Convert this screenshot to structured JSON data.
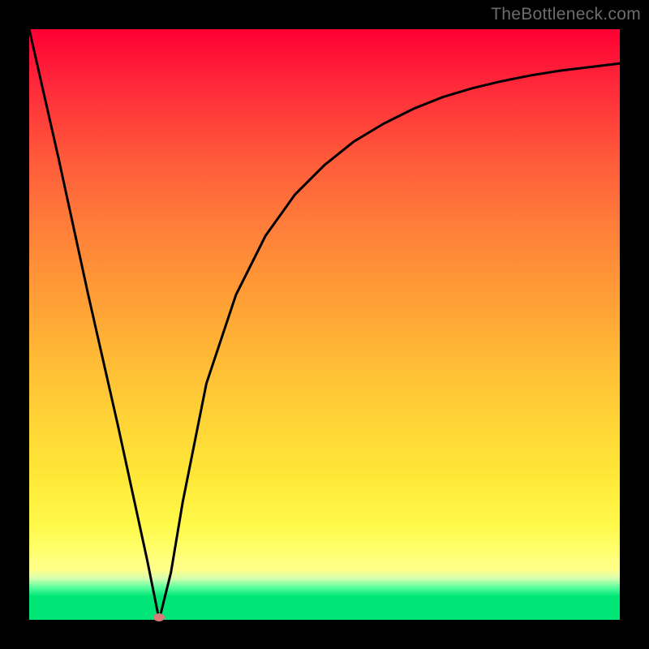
{
  "watermark_text": "TheBottleneck.com",
  "colors": {
    "frame_bg": "#000",
    "curve_stroke": "#000",
    "marker_fill": "#d87b7b",
    "watermark": "#6a6c6d"
  },
  "chart_data": {
    "type": "line",
    "title": "",
    "xlabel": "",
    "ylabel": "",
    "xlim": [
      0,
      100
    ],
    "ylim": [
      0,
      100
    ],
    "grid": false,
    "legend": false,
    "series": [
      {
        "name": "bottleneck-curve",
        "x": [
          0,
          5,
          10,
          15,
          20,
          22,
          24,
          26,
          30,
          35,
          40,
          45,
          50,
          55,
          60,
          65,
          70,
          75,
          80,
          85,
          90,
          95,
          100
        ],
        "y": [
          100,
          78,
          55,
          33,
          10,
          0,
          8,
          20,
          40,
          55,
          65,
          72,
          77,
          81,
          84,
          86.5,
          88.5,
          90,
          91.2,
          92.2,
          93,
          93.6,
          94.2
        ]
      }
    ],
    "annotations": [
      {
        "name": "min-marker",
        "x": 22,
        "y": 0
      }
    ],
    "background_gradient": {
      "direction": "top-to-bottom",
      "stops": [
        {
          "pos": 0,
          "color": "#ff0033"
        },
        {
          "pos": 50,
          "color": "#ffb836"
        },
        {
          "pos": 85,
          "color": "#fff94a"
        },
        {
          "pos": 96,
          "color": "#00e676"
        }
      ]
    }
  }
}
